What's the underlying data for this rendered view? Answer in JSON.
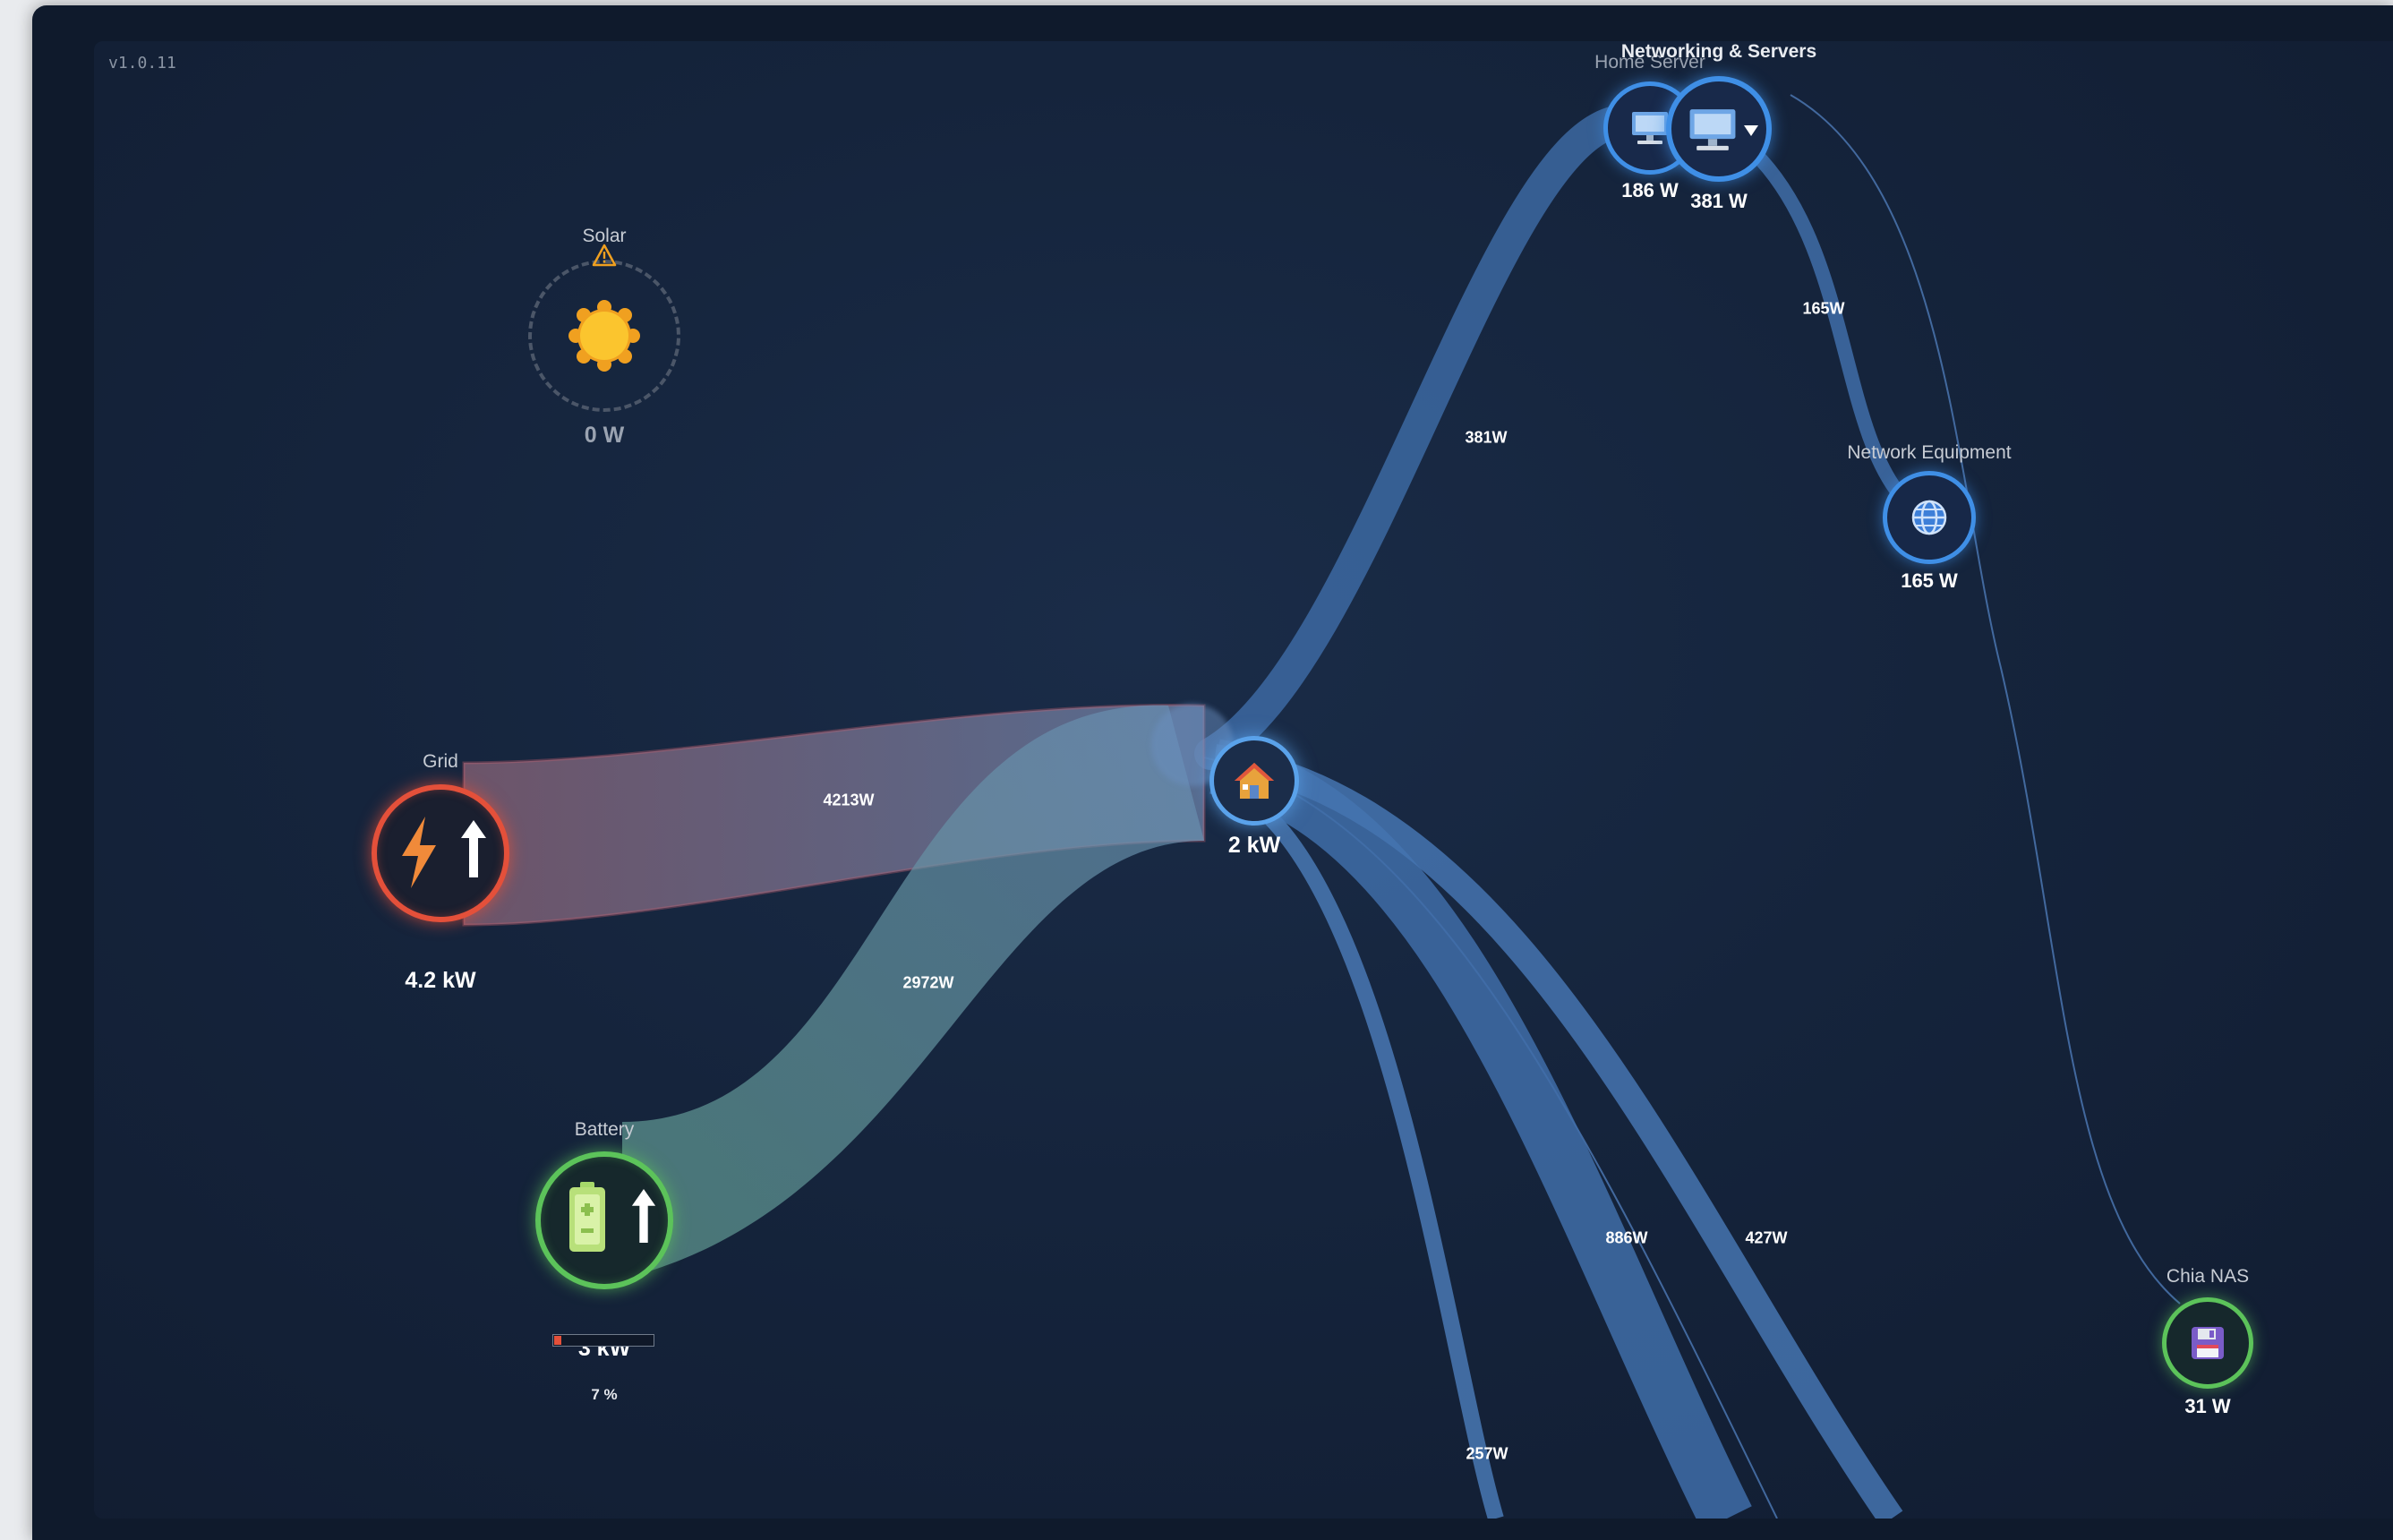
{
  "app": {
    "version": "v1.0.11"
  },
  "colors": {
    "grid": "#e4503a",
    "battery": "#5cc35a",
    "consumer": "#3f8fe6",
    "home": "#5aa2ea",
    "background": "#15243c"
  },
  "nodes": {
    "solar": {
      "title": "Solar",
      "value": "0 W",
      "icon": "sun-icon",
      "warning_icon": "warning-icon"
    },
    "grid": {
      "title": "Grid",
      "value": "4.2 kW",
      "icon": "lightning-icon",
      "direction_icon": "arrow-up-icon"
    },
    "battery": {
      "title": "Battery",
      "value": "3 kW",
      "percent": "7 %",
      "level": 0.07,
      "icon": "battery-icon",
      "direction_icon": "arrow-up-icon"
    },
    "home": {
      "value": "2 kW",
      "icon": "house-icon"
    },
    "group": {
      "title": "Networking & Servers",
      "icon": "chevron-down-icon"
    },
    "home_server": {
      "title": "Home Server",
      "value": "186 W",
      "icon": "computer-icon"
    },
    "group_total": {
      "value": "381 W",
      "icon": "computer-icon"
    },
    "network_equipment": {
      "title": "Network Equipment",
      "value": "165 W",
      "icon": "globe-icon"
    },
    "chia_nas": {
      "title": "Chia NAS",
      "value": "31 W",
      "icon": "floppy-disk-icon"
    }
  },
  "flows": {
    "grid_to_home": "4213W",
    "battery_to_home": "2972W",
    "home_to_servers": "381W",
    "servers_to_network": "165W",
    "out_886": "886W",
    "out_427": "427W",
    "out_257": "257W"
  }
}
